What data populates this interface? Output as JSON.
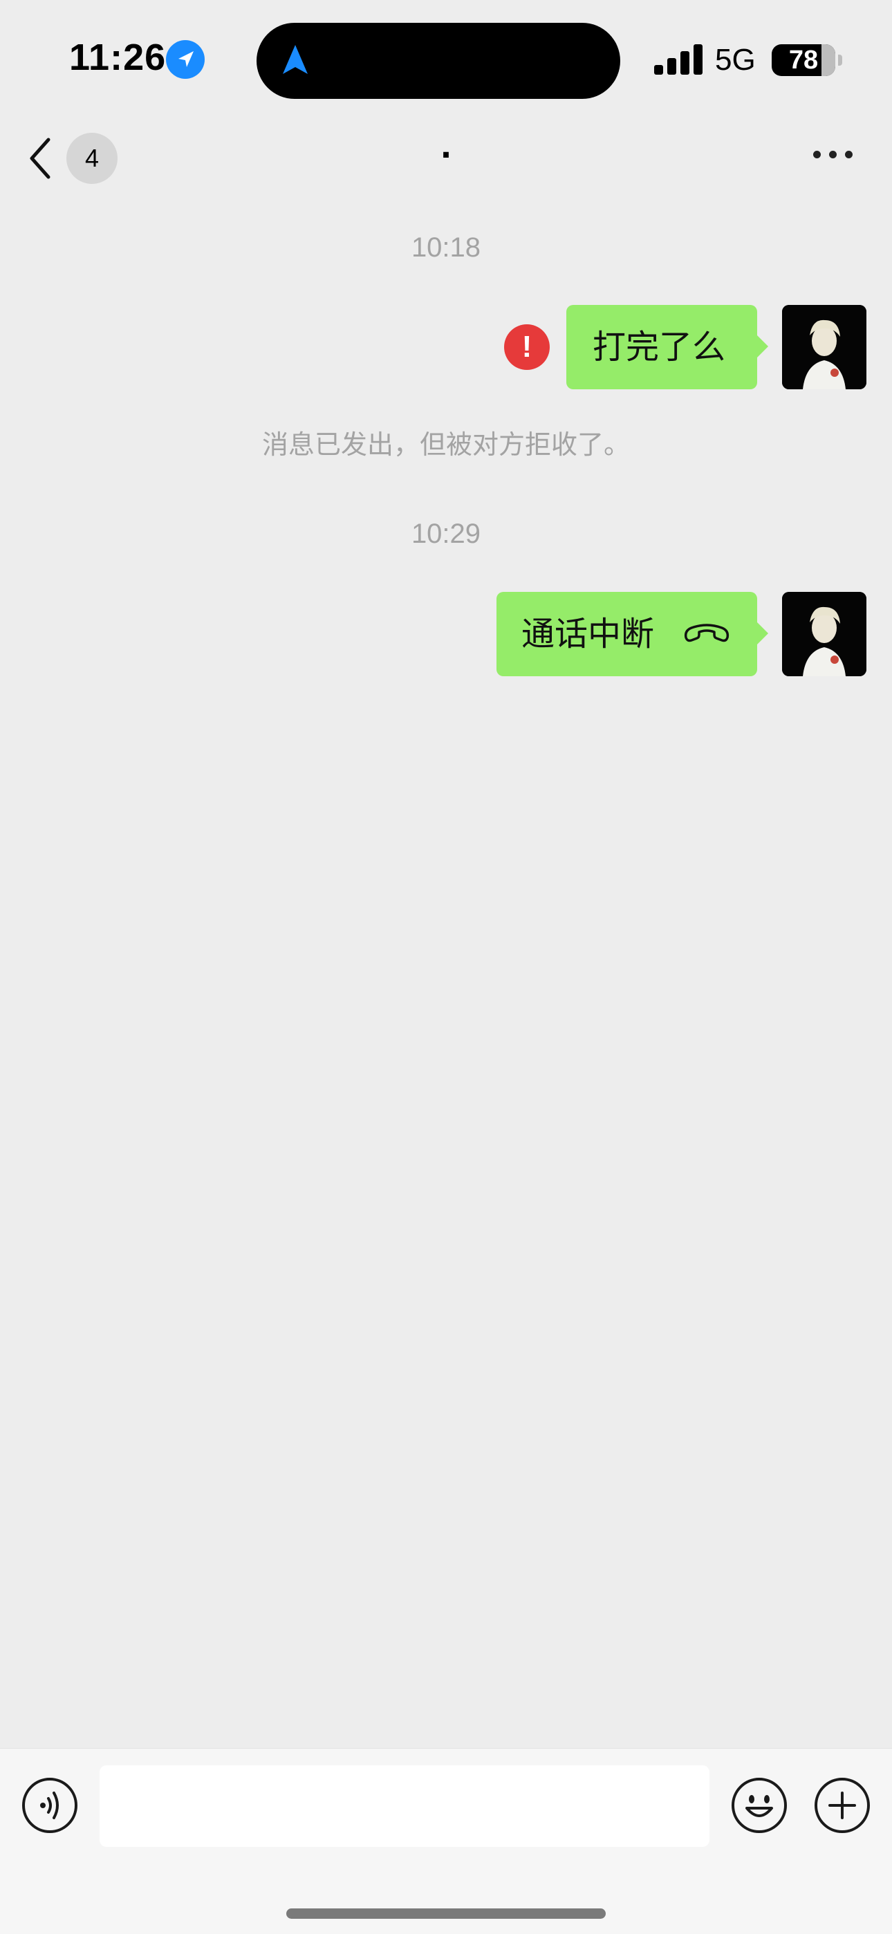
{
  "status_bar": {
    "time": "11:26",
    "network": "5G",
    "battery": "78"
  },
  "nav": {
    "unread_count": "4",
    "title": ".",
    "more_icon": "ellipsis-icon"
  },
  "messages": [
    {
      "type": "timestamp",
      "text": "10:18"
    },
    {
      "type": "outgoing",
      "text": "打完了么",
      "status": "rejected"
    },
    {
      "type": "system",
      "text": "消息已发出，但被对方拒收了。"
    },
    {
      "type": "timestamp",
      "text": "10:29"
    },
    {
      "type": "outgoing_call",
      "text": "通话中断",
      "icon": "phone-hangup-icon"
    }
  ],
  "input": {
    "value": "",
    "placeholder": ""
  },
  "colors": {
    "background": "#ededed",
    "bubble_outgoing": "#95ec69",
    "error": "#e63a3a",
    "location_accent": "#1a8cff"
  }
}
